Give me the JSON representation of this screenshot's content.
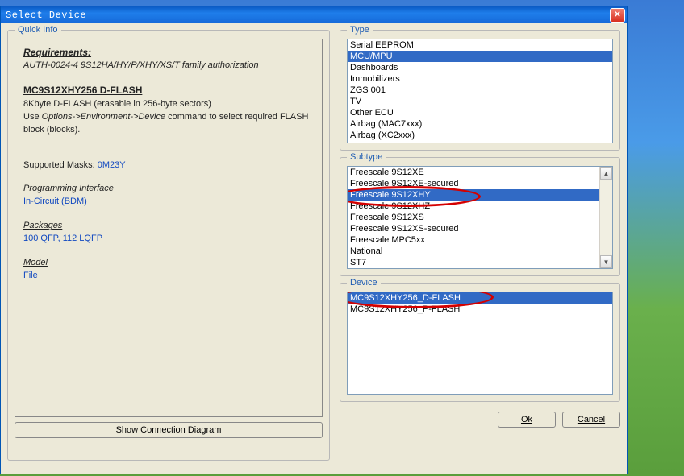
{
  "window": {
    "title": "Select Device"
  },
  "left": {
    "groupTitle": "Quick Info",
    "requirements_h": "Requirements:",
    "auth_line": "AUTH-0024-4  9S12HA/HY/P/XHY/XS/T family authorization",
    "device_name": "MC9S12XHY256 D-FLASH",
    "desc1": "8Kbyte D-FLASH (erasable in 256-byte sectors)",
    "desc2a": "Use ",
    "desc2b": "Options->Environment->Device",
    "desc2c": " command to select required FLASH block (blocks).",
    "masks_label": "Supported Masks: ",
    "masks_value": "0M23Y",
    "prog_if_h": "Programming Interface",
    "prog_if_v": "In-Circuit (BDM)",
    "packages_h": "Packages",
    "packages_v": "100 QFP, 112 LQFP",
    "model_h": "Model",
    "model_v": "File",
    "conn_btn": "Show Connection Diagram"
  },
  "type": {
    "title": "Type",
    "items": [
      "Serial EEPROM",
      "MCU/MPU",
      "Dashboards",
      "Immobilizers",
      "ZGS 001",
      "TV",
      "Other ECU",
      "Airbag (MAC7xxx)",
      "Airbag (XC2xxx)"
    ],
    "selected": 1
  },
  "subtype": {
    "title": "Subtype",
    "items": [
      "Freescale 9S12XE",
      "Freescale 9S12XE-secured",
      "Freescale 9S12XHY",
      "Freescale 9S12XHZ",
      "Freescale 9S12XS",
      "Freescale 9S12XS-secured",
      "Freescale MPC5xx",
      "National",
      "ST7"
    ],
    "selected": 2
  },
  "device": {
    "title": "Device",
    "items": [
      "MC9S12XHY256_D-FLASH",
      "MC9S12XHY256_P-FLASH"
    ],
    "selected": 0
  },
  "buttons": {
    "ok": "Ok",
    "cancel": "Cancel"
  }
}
